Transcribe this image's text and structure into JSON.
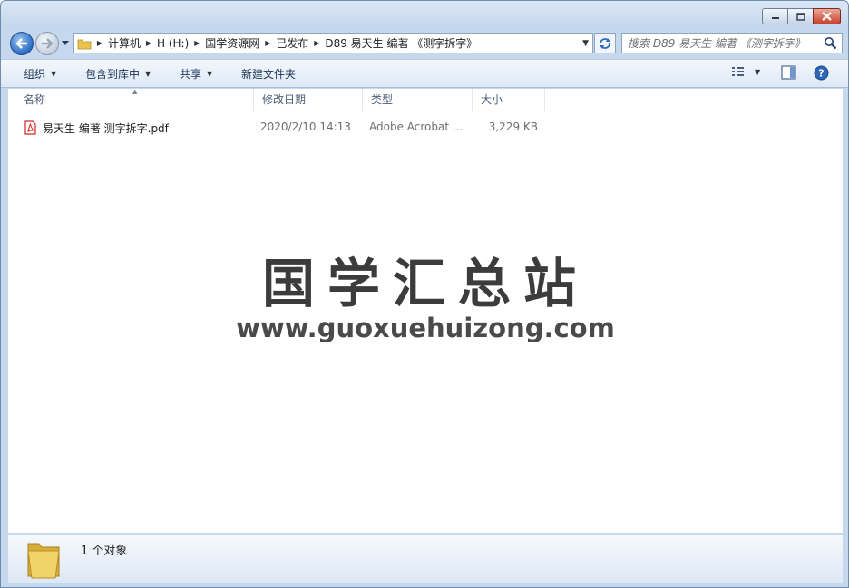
{
  "window": {
    "caption_buttons": [
      "minimize-icon",
      "maximize-icon",
      "close-icon"
    ]
  },
  "address_bar": {
    "breadcrumbs": [
      "计算机",
      "H (H:)",
      "国学资源网",
      "已发布",
      "D89 易天生 编著 《测字拆字》"
    ]
  },
  "search": {
    "placeholder": "搜索 D89 易天生 编著 《测字拆字》"
  },
  "toolbar": {
    "organize": "组织",
    "include_in_library": "包含到库中",
    "share": "共享",
    "new_folder": "新建文件夹"
  },
  "columns": {
    "name": "名称",
    "date_modified": "修改日期",
    "type": "类型",
    "size": "大小"
  },
  "files": [
    {
      "name": "易天生 编著 测字拆字.pdf",
      "date_modified": "2020/2/10 14:13",
      "type": "Adobe Acrobat ...",
      "size": "3,229 KB",
      "icon": "pdf-icon"
    }
  ],
  "watermark": {
    "title": "国学汇总站",
    "url": "www.guoxuehuizong.com"
  },
  "details": {
    "count": "1 个对象"
  },
  "colors": {
    "frame": "#c5d8ee",
    "toolbar_text": "#1e3557",
    "pdf_red": "#d3271d",
    "folder_yellow": "#e8c44f"
  }
}
